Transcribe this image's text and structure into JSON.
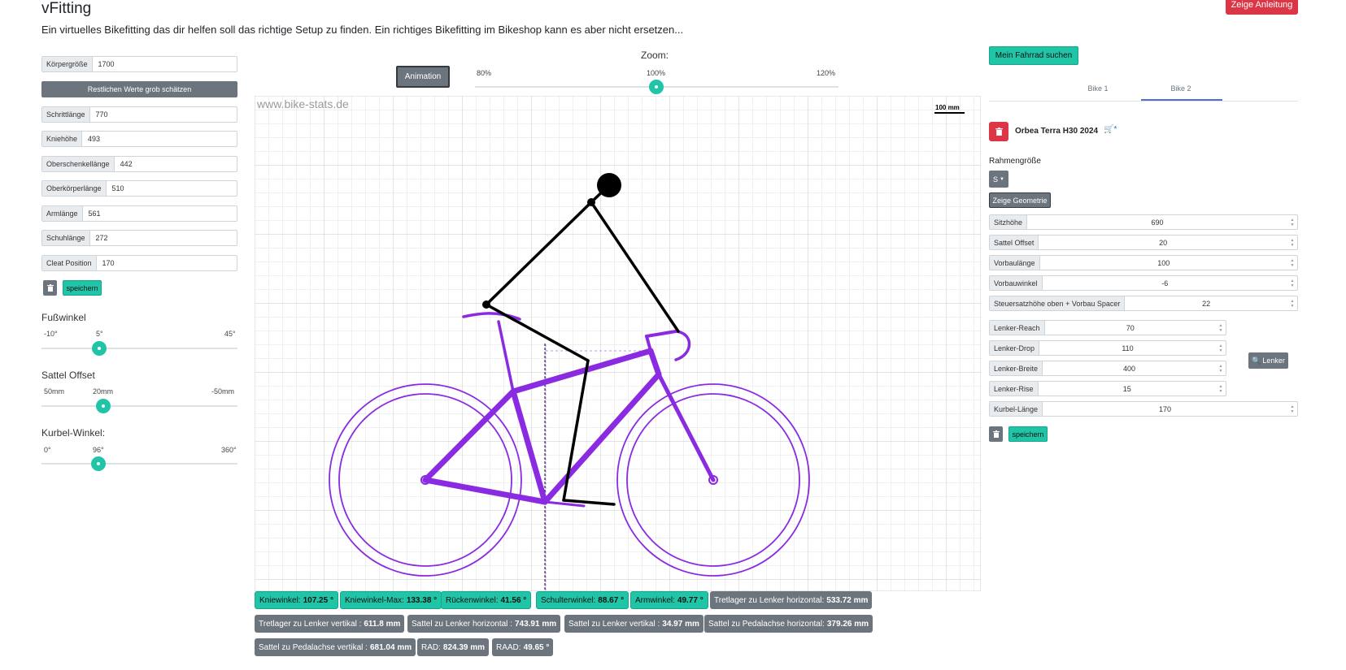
{
  "header": {
    "title": "vFitting",
    "subtitle": "Ein virtuelles Bikefitting das dir helfen soll das richtige Setup zu finden. Ein richtiges Bikefitting im Bikeshop kann es aber nicht ersetzen...",
    "guide_button": "Zeige Anleitung"
  },
  "body_inputs": {
    "height_label": "Körpergröße",
    "height_value": "1700",
    "estimate_button": "Restlichen Werte grob schätzen",
    "fields": [
      {
        "label": "Schrittlänge",
        "value": "770"
      },
      {
        "label": "Kniehöhe",
        "value": "493"
      },
      {
        "label": "Oberschenkellänge",
        "value": "442"
      },
      {
        "label": "Oberkörperlänge",
        "value": "510"
      },
      {
        "label": "Armlänge",
        "value": "561"
      },
      {
        "label": "Schuhlänge",
        "value": "272"
      },
      {
        "label": "Cleat Position",
        "value": "170"
      }
    ],
    "save_button": "speichern"
  },
  "sliders": {
    "foot_angle": {
      "title": "Fußwinkel",
      "min": "-10°",
      "current": "5°",
      "max": "45°",
      "fraction": 0.27
    },
    "saddle_offset": {
      "title": "Sattel Offset",
      "min": "50mm",
      "current": "20mm",
      "max": "-50mm",
      "fraction": 0.3
    },
    "crank_angle": {
      "title": "Kurbel-Winkel:",
      "min": "0°",
      "current": "96°",
      "max": "360°",
      "fraction": 0.27
    }
  },
  "canvas": {
    "animation_button": "Animation",
    "zoom_title": "Zoom:",
    "zoom_min": "80%",
    "zoom_current": "100%",
    "zoom_max": "120%",
    "zoom_fraction": 0.5,
    "watermark": "www.bike-stats.de",
    "scale_label": "100 mm",
    "colors": {
      "bike": "#8a2be2",
      "rider": "#000000",
      "grid": "#dedede"
    }
  },
  "metrics": [
    {
      "label": "Kniewinkel:",
      "value": "107.25 °",
      "style": "teal"
    },
    {
      "label": "Kniewinkel-Max:",
      "value": "133.38 °",
      "style": "teal"
    },
    {
      "label": "Rückenwinkel:",
      "value": "41.56 °",
      "style": "teal"
    },
    {
      "label": "Schulterwinkel:",
      "value": "88.67 °",
      "style": "teal"
    },
    {
      "label": "Armwinkel:",
      "value": "49.77 °",
      "style": "teal"
    },
    {
      "label": "Tretlager zu Lenker horizontal:",
      "value": "533.72 mm",
      "style": "grey"
    },
    {
      "label": "Tretlager zu Lenker vertikal :",
      "value": "611.8 mm",
      "style": "grey"
    },
    {
      "label": "Sattel zu Lenker horizontal :",
      "value": "743.91 mm",
      "style": "grey"
    },
    {
      "label": "Sattel zu Lenker vertikal :",
      "value": "34.97 mm",
      "style": "grey"
    },
    {
      "label": "Sattel zu Pedalachse horizontal:",
      "value": "379.26 mm",
      "style": "grey"
    },
    {
      "label": "Sattel zu Pedalachse vertikal :",
      "value": "681.04 mm",
      "style": "grey"
    },
    {
      "label": "RAD:",
      "value": "824.39 mm",
      "style": "grey"
    },
    {
      "label": "RAAD:",
      "value": "49.65 °",
      "style": "grey"
    }
  ],
  "bike_panel": {
    "search_button": "Mein Fahrrad suchen",
    "tabs": [
      "Bike 1",
      "Bike 2"
    ],
    "active_tab": "Bike 2",
    "bike_name": "Orbea Terra H30 2024",
    "frame_size_label": "Rahmengröße",
    "frame_size_value": "S",
    "geometry_button": "Zeige Geometrie",
    "fields": [
      {
        "label": "Sitzhöhe",
        "value": "690"
      },
      {
        "label": "Sattel Offset",
        "value": "20"
      },
      {
        "label": "Vorbaulänge",
        "value": "100"
      },
      {
        "label": "Vorbauwinkel",
        "value": "-6"
      },
      {
        "label": "Steuersatzhöhe oben + Vorbau Spacer",
        "value": "22"
      }
    ],
    "bar_fields": [
      {
        "label": "Lenker-Reach",
        "value": "70"
      },
      {
        "label": "Lenker-Drop",
        "value": "110"
      },
      {
        "label": "Lenker-Breite",
        "value": "400"
      },
      {
        "label": "Lenker-Rise",
        "value": "15"
      }
    ],
    "crank": {
      "label": "Kurbel-Länge",
      "value": "170"
    },
    "bar_search_button": "Lenker",
    "save_button": "speichern"
  }
}
